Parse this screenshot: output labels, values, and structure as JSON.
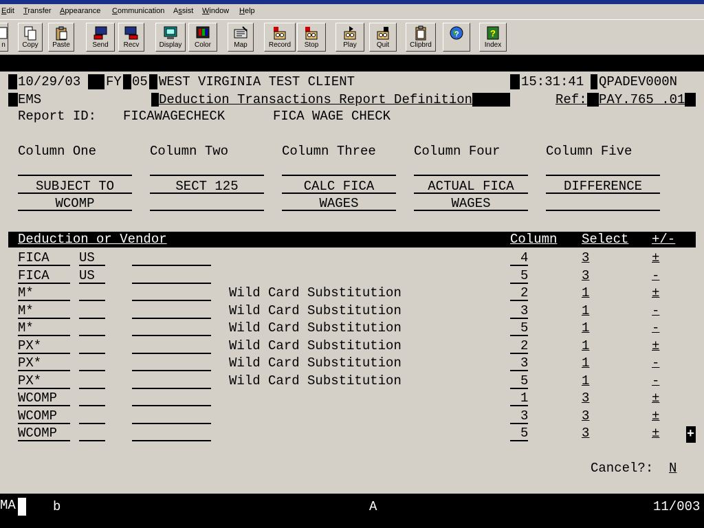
{
  "menu": [
    "Edit",
    "Transfer",
    "Appearance",
    "Communication",
    "Assist",
    "Window",
    "Help"
  ],
  "menu_ul": [
    "E",
    "T",
    "A",
    "C",
    "s",
    "W",
    "H"
  ],
  "toolbar": [
    {
      "label": "n",
      "icon": "partial-icon"
    },
    {
      "label": "Copy",
      "icon": "copy-icon"
    },
    {
      "label": "Paste",
      "icon": "paste-icon"
    },
    {
      "label": "Send",
      "icon": "send-icon"
    },
    {
      "label": "Recv",
      "icon": "receive-icon"
    },
    {
      "label": "Display",
      "icon": "display-icon"
    },
    {
      "label": "Color",
      "icon": "color-icon"
    },
    {
      "label": "Map",
      "icon": "map-icon"
    },
    {
      "label": "Record",
      "icon": "record-icon"
    },
    {
      "label": "Stop",
      "icon": "stop-icon"
    },
    {
      "label": "Play",
      "icon": "play-icon"
    },
    {
      "label": "Quit",
      "icon": "quit-icon"
    },
    {
      "label": "Clipbrd",
      "icon": "clipboard-icon"
    },
    {
      "label": "",
      "icon": "help-globe-icon"
    },
    {
      "label": "Index",
      "icon": "index-icon"
    }
  ],
  "header": {
    "date": "10/29/03",
    "fy_label": "FY",
    "fy": "05",
    "client": "WEST VIRGINIA TEST CLIENT",
    "time": "15:31:41",
    "system": "QPADEV000N",
    "app": "EMS",
    "title": "Deduction Transactions Report Definition",
    "ref_label": "Ref:",
    "ref": "PAY.765 .01"
  },
  "report": {
    "id_label": "Report ID:",
    "id": "FICAWAGECHECK",
    "desc": "FICA WAGE CHECK"
  },
  "columns": {
    "headers": [
      "Column One",
      "Column Two",
      "Column Three",
      "Column Four",
      "Column Five"
    ],
    "line1": [
      "",
      "",
      "",
      "",
      ""
    ],
    "line2": [
      "SUBJECT TO",
      "SECT 125",
      "CALC FICA",
      "ACTUAL FICA",
      "DIFFERENCE"
    ],
    "line3": [
      "WCOMP",
      "",
      "WAGES",
      "WAGES",
      ""
    ]
  },
  "table": {
    "header": {
      "ded": "Deduction or Vendor",
      "col": "Column",
      "sel": "Select",
      "pm": "+/-"
    },
    "rows": [
      {
        "code": "FICA",
        "c2": "US",
        "c3": "",
        "note": "",
        "col": "4",
        "sel": "3",
        "pm": "±"
      },
      {
        "code": "FICA",
        "c2": "US",
        "c3": "",
        "note": "",
        "col": "5",
        "sel": "3",
        "pm": "-"
      },
      {
        "code": "M*",
        "c2": "",
        "c3": "",
        "note": "Wild Card Substitution",
        "col": "2",
        "sel": "1",
        "pm": "±"
      },
      {
        "code": "M*",
        "c2": "",
        "c3": "",
        "note": "Wild Card Substitution",
        "col": "3",
        "sel": "1",
        "pm": "-"
      },
      {
        "code": "M*",
        "c2": "",
        "c3": "",
        "note": "Wild Card Substitution",
        "col": "5",
        "sel": "1",
        "pm": "-"
      },
      {
        "code": "PX*",
        "c2": "",
        "c3": "",
        "note": "Wild Card Substitution",
        "col": "2",
        "sel": "1",
        "pm": "±"
      },
      {
        "code": "PX*",
        "c2": "",
        "c3": "",
        "note": "Wild Card Substitution",
        "col": "3",
        "sel": "1",
        "pm": "-"
      },
      {
        "code": "PX*",
        "c2": "",
        "c3": "",
        "note": "Wild Card Substitution",
        "col": "5",
        "sel": "1",
        "pm": "-"
      },
      {
        "code": "WCOMP",
        "c2": "",
        "c3": "",
        "note": "",
        "col": "1",
        "sel": "3",
        "pm": "±"
      },
      {
        "code": "WCOMP",
        "c2": "",
        "c3": "",
        "note": "",
        "col": "3",
        "sel": "3",
        "pm": "±"
      },
      {
        "code": "WCOMP",
        "c2": "",
        "c3": "",
        "note": "",
        "col": "5",
        "sel": "3",
        "pm": "±"
      }
    ]
  },
  "more_indicator": "+",
  "cancel": {
    "label": "Cancel?:",
    "value": "N"
  },
  "status": {
    "left": "MA",
    "b": "b",
    "mid": "A",
    "right": "11/003"
  }
}
